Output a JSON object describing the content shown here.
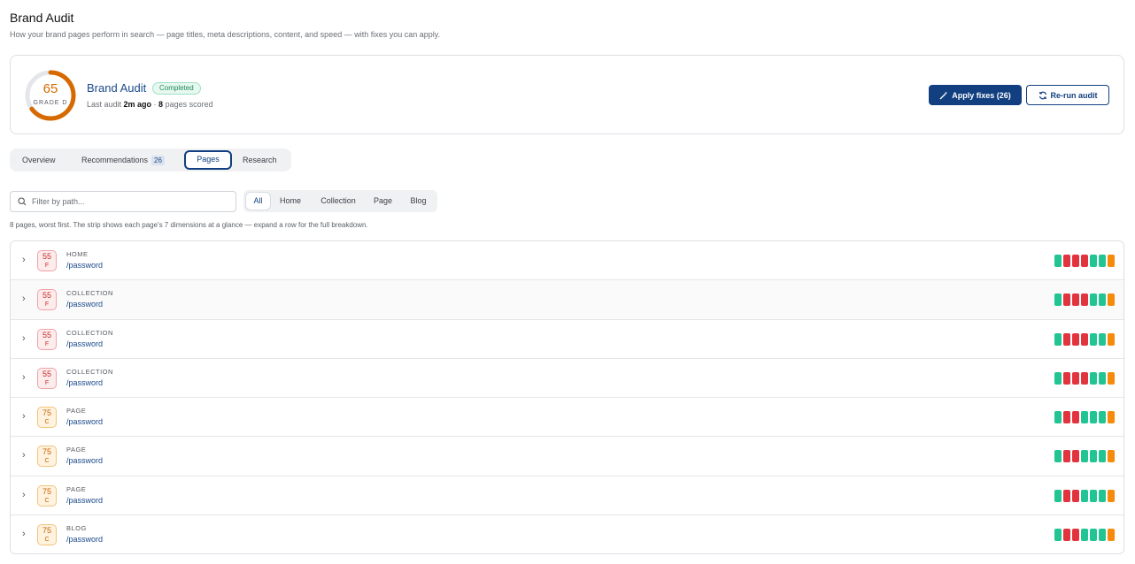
{
  "header": {
    "title": "Brand Audit",
    "subtitle": "How your brand pages perform in search — page titles, meta descriptions, content, and speed — with fixes you can apply."
  },
  "summary": {
    "score": "65",
    "score_fraction": 0.65,
    "grade": "GRADE D",
    "name": "Brand Audit",
    "status": "Completed",
    "meta_prefix": "Last audit ",
    "meta_time": "2m ago",
    "meta_sep": " · ",
    "meta_count": "8",
    "meta_suffix": " pages scored",
    "apply_label": "Apply fixes (26)",
    "rerun_label": "Re-run audit"
  },
  "tabs": [
    {
      "label": "Overview"
    },
    {
      "label": "Recommendations",
      "count": "26"
    },
    {
      "label": "Pages"
    },
    {
      "label": "Research"
    }
  ],
  "filter": {
    "placeholder": "Filter by path..."
  },
  "type_filters": [
    "All",
    "Home",
    "Collection",
    "Page",
    "Blog"
  ],
  "hint": "8 pages, worst first. The strip shows each page's 7 dimensions at a glance — expand a row for the full breakdown.",
  "colors": {
    "good": "#22c493",
    "bad": "#e1343f",
    "warn": "#f58a0b",
    "accent": "#123f80"
  },
  "rows": [
    {
      "score": "55",
      "grade": "F",
      "type": "HOME",
      "path": "/password",
      "strip": [
        "good",
        "bad",
        "bad",
        "bad",
        "good",
        "good",
        "warn"
      ]
    },
    {
      "score": "55",
      "grade": "F",
      "type": "COLLECTION",
      "path": "/password",
      "strip": [
        "good",
        "bad",
        "bad",
        "bad",
        "good",
        "good",
        "warn"
      ]
    },
    {
      "score": "55",
      "grade": "F",
      "type": "COLLECTION",
      "path": "/password",
      "strip": [
        "good",
        "bad",
        "bad",
        "bad",
        "good",
        "good",
        "warn"
      ]
    },
    {
      "score": "55",
      "grade": "F",
      "type": "COLLECTION",
      "path": "/password",
      "strip": [
        "good",
        "bad",
        "bad",
        "bad",
        "good",
        "good",
        "warn"
      ]
    },
    {
      "score": "75",
      "grade": "C",
      "type": "PAGE",
      "path": "/password",
      "strip": [
        "good",
        "bad",
        "bad",
        "good",
        "good",
        "good",
        "warn"
      ]
    },
    {
      "score": "75",
      "grade": "C",
      "type": "PAGE",
      "path": "/password",
      "strip": [
        "good",
        "bad",
        "bad",
        "good",
        "good",
        "good",
        "warn"
      ]
    },
    {
      "score": "75",
      "grade": "C",
      "type": "PAGE",
      "path": "/password",
      "strip": [
        "good",
        "bad",
        "bad",
        "good",
        "good",
        "good",
        "warn"
      ]
    },
    {
      "score": "75",
      "grade": "C",
      "type": "BLOG",
      "path": "/password",
      "strip": [
        "good",
        "bad",
        "bad",
        "good",
        "good",
        "good",
        "warn"
      ]
    }
  ]
}
